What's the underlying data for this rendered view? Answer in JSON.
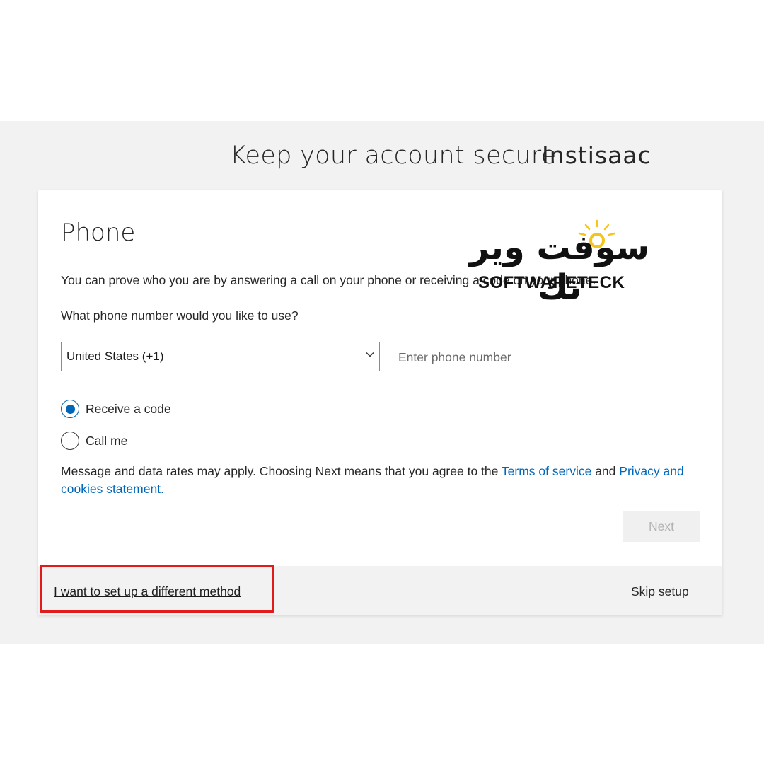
{
  "header": {
    "title": "Keep your account secure",
    "org_name": "Instisaac"
  },
  "card": {
    "heading": "Phone",
    "description": "You can prove who you are by answering a call on your phone or receiving a code on your phone.",
    "question": "What phone number would you like to use?",
    "country_select": {
      "selected": "United States (+1)"
    },
    "phone_input": {
      "value": "",
      "placeholder": "Enter phone number"
    },
    "options": [
      {
        "label": "Receive a code",
        "checked": true
      },
      {
        "label": "Call me",
        "checked": false
      }
    ],
    "terms": {
      "prefix": "Message and data rates may apply. Choosing Next means that you agree to the",
      "terms_link": "Terms of service",
      "conjunction": "and",
      "privacy_link": "Privacy and cookies statement."
    },
    "next_label": "Next",
    "next_enabled": false
  },
  "footer": {
    "alt_method_label": "I want to set up a different method",
    "skip_label": "Skip setup"
  },
  "watermark": {
    "arabic": "سوفت وير تك",
    "latin": "SOFTWARETECK"
  },
  "colors": {
    "accent": "#0067b8",
    "highlight": "#e11b1b",
    "band": "#f2f2f2"
  },
  "icons": [
    "chevron-down-icon",
    "radio-checked-icon",
    "radio-unchecked-icon",
    "sun-logo-icon"
  ]
}
